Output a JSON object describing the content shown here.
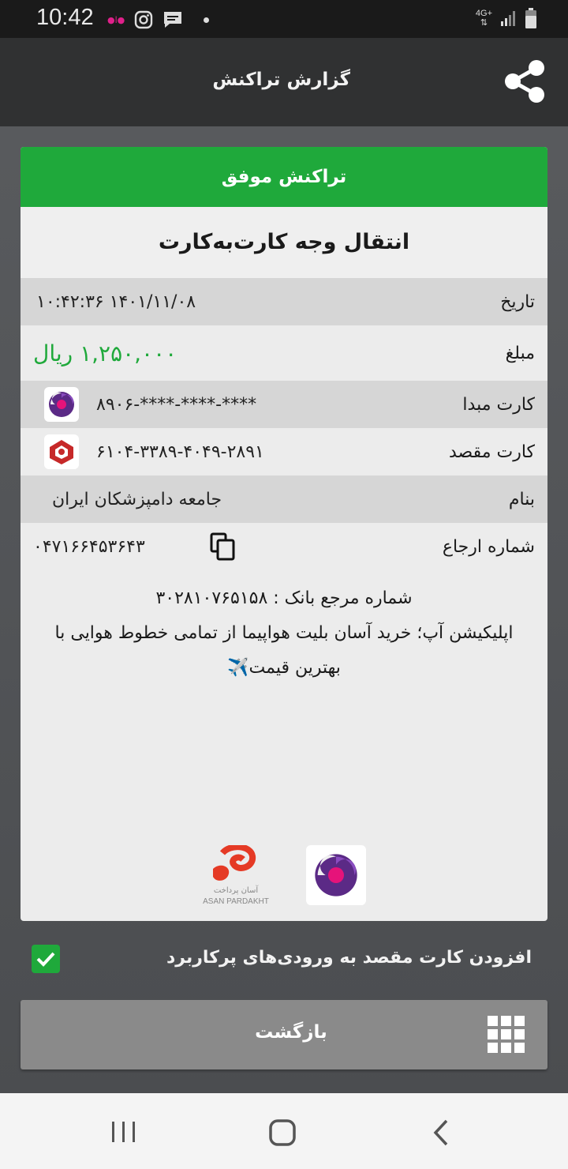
{
  "status_bar": {
    "time": "10:42",
    "network": "4G+",
    "icons": [
      "notification-app-icon",
      "instagram-icon",
      "message-icon",
      "dot-icon",
      "signal-icon",
      "battery-icon"
    ]
  },
  "app_bar": {
    "title": "گزارش تراکنش",
    "share_icon": "share-icon"
  },
  "receipt": {
    "status": "تراکنش موفق",
    "status_color": "#1fa93b",
    "type": "انتقال وجه کارت‌به‌کارت",
    "rows": {
      "date": {
        "label": "تاریخ",
        "value": "۱۴۰۱/۱۱/۰۸ ۱۰:۴۲:۳۶"
      },
      "amount": {
        "label": "مبلغ",
        "value": "۱,۲۵۰,۰۰۰ ریال",
        "color": "#1fa93b"
      },
      "source_card": {
        "label": "کارت مبدا",
        "value": "****-****-****-۸۹۰۶"
      },
      "dest_card": {
        "label": "کارت مقصد",
        "value": "۶۱۰۴-۳۳۸۹-۴۰۴۹-۲۸۹۱"
      },
      "name": {
        "label": "بنام",
        "value": "جامعه دامپزشکان ایران"
      },
      "reference": {
        "label": "شماره ارجاع",
        "value": "۰۴۷۱۶۶۴۵۳۶۴۳"
      }
    },
    "bank_reference": "شماره مرجع بانک : ۳۰۲۸۱۰۷۶۵۱۵۸",
    "promo": "اپلیکیشن آپ؛ خرید آسان بلیت هواپیما از تمامی خطوط هوایی با بهترین قیمت✈️",
    "footer_logo_text": "ASAN PARDAKHT"
  },
  "favorite": {
    "label": "افزودن کارت مقصد به ورودی‌های پرکاربرد",
    "checked": true
  },
  "back_button": {
    "label": "بازگشت"
  }
}
